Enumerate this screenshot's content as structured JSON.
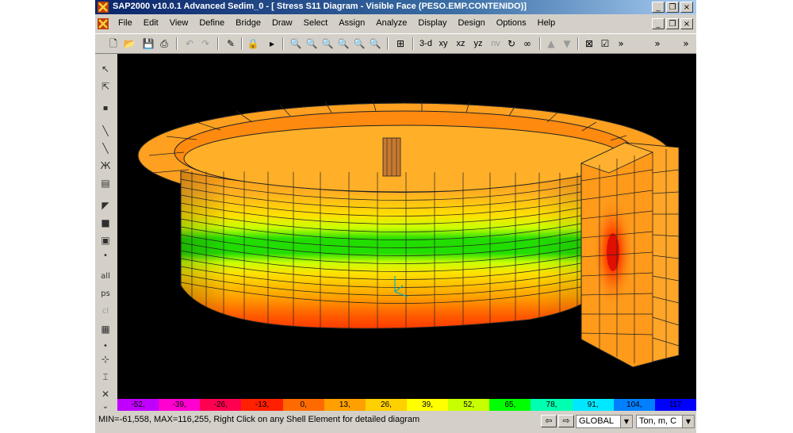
{
  "window": {
    "title": "SAP2000 v10.0.1  Advanced    Sedim_0 - [  Stress S11 Diagram - Visible Face  (PESO.EMP.CONTENIDO)]",
    "minimize_glyph": "_",
    "restore_glyph": "❐",
    "close_glyph": "×"
  },
  "menu": [
    "File",
    "Edit",
    "View",
    "Define",
    "Bridge",
    "Draw",
    "Select",
    "Assign",
    "Analyze",
    "Display",
    "Design",
    "Options",
    "Help"
  ],
  "toolbar": {
    "view_3d": "3-d",
    "view_xy": "xy",
    "view_xz": "xz",
    "view_yz": "yz",
    "view_nv": "nv",
    "more_glyph": "»"
  },
  "left_toolbar": {
    "all_label": "all",
    "ps_label": "ps",
    "cl_label": "cl"
  },
  "colorbar": {
    "values": [
      "-52,",
      "-39,",
      "-26,",
      "-13,",
      "0,",
      "13,",
      "26,",
      "39,",
      "52,",
      "65,",
      "78,",
      "91,",
      "104,",
      "117"
    ],
    "colors": [
      "#c000ff",
      "#ff00d0",
      "#ff0050",
      "#ff2000",
      "#ff6a00",
      "#ffa000",
      "#ffd000",
      "#ffff00",
      "#c8ff00",
      "#00ff00",
      "#00ffb0",
      "#00e8ff",
      "#0080ff",
      "#0000ff"
    ]
  },
  "status": {
    "text": "MIN=-61,558, MAX=116,255, Right Click on any Shell Element for detailed diagram",
    "coord_system": "GLOBAL",
    "units": "Ton, m, C"
  },
  "colors": {
    "viewport_bg": "#000000",
    "shell_orange": "#ff9a1a",
    "shell_yellow": "#ffe000",
    "shell_green": "#22dd00",
    "shell_red": "#ff3a00"
  }
}
